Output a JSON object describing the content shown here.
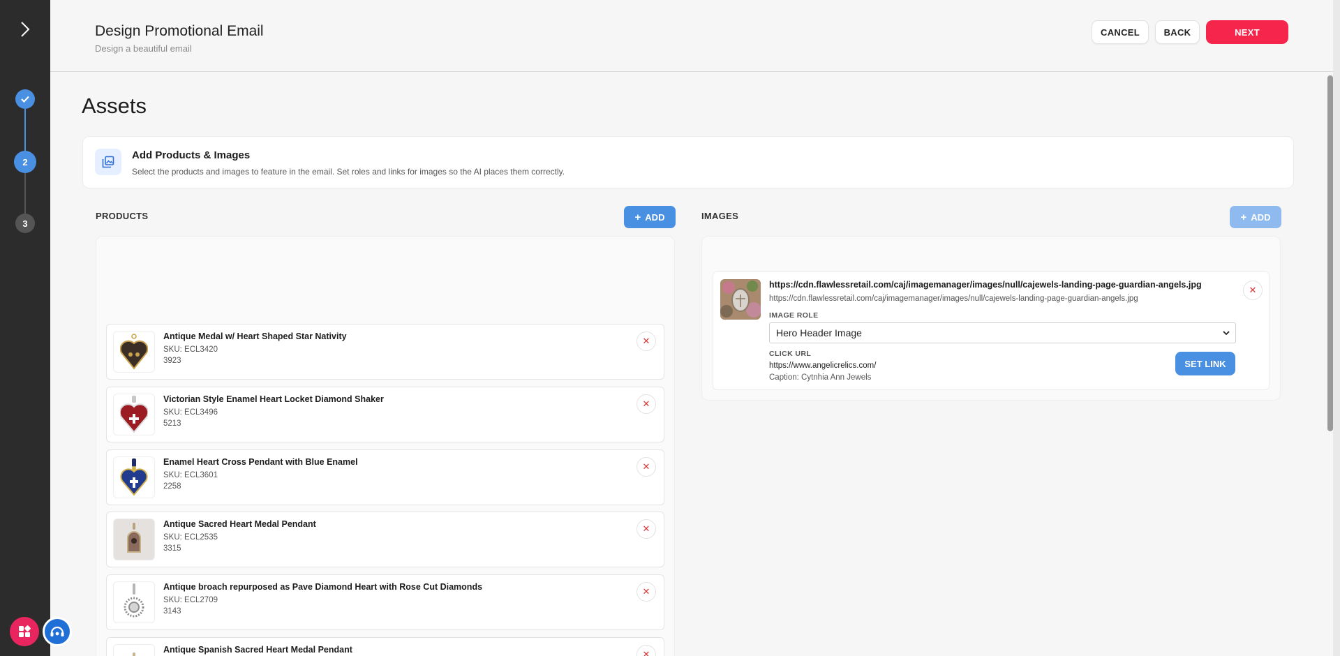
{
  "header": {
    "title": "Design Promotional Email",
    "subtitle": "Design a beautiful email",
    "cancel_label": "CANCEL",
    "back_label": "BACK",
    "next_label": "NEXT"
  },
  "steps": [
    {
      "label": "",
      "state": "done",
      "icon": "check-icon"
    },
    {
      "label": "2",
      "state": "active"
    },
    {
      "label": "3",
      "state": "todo"
    }
  ],
  "page": {
    "title": "Assets",
    "info_title": "Add Products & Images",
    "info_desc": "Select the products and images to feature in the email. Set roles and links for images so the AI places them correctly."
  },
  "products": {
    "label": "PRODUCTS",
    "add_label": "ADD",
    "items": [
      {
        "name": "Antique Medal w/ Heart Shaped Star Nativity",
        "sku": "SKU: ECL3420",
        "qty": "3923",
        "thumb": "medal"
      },
      {
        "name": "Victorian Style Enamel Heart Locket Diamond Shaker",
        "sku": "SKU: ECL3496",
        "qty": "5213",
        "thumb": "red-heart"
      },
      {
        "name": "Enamel Heart Cross Pendant with Blue Enamel",
        "sku": "SKU: ECL3601",
        "qty": "2258",
        "thumb": "blue-heart"
      },
      {
        "name": "Antique Sacred Heart Medal Pendant",
        "sku": "SKU: ECL2535",
        "qty": "3315",
        "thumb": "sacred-medal"
      },
      {
        "name": "Antique broach repurposed as Pave Diamond Heart with Rose Cut Diamonds",
        "sku": "SKU: ECL2709",
        "qty": "3143",
        "thumb": "broach"
      },
      {
        "name": "Antique Spanish Sacred Heart Medal Pendant",
        "sku": "",
        "qty": "",
        "thumb": "spanish-medal"
      }
    ]
  },
  "images": {
    "label": "IMAGES",
    "add_label": "ADD",
    "items": [
      {
        "url_bold": "https://cdn.flawlessretail.com/caj/imagemanager/images/null/cajewels-landing-page-guardian-angels.jpg",
        "url": "https://cdn.flawlessretail.com/caj/imagemanager/images/null/cajewels-landing-page-guardian-angels.jpg",
        "role_label": "IMAGE ROLE",
        "role_value": "Hero Header Image",
        "click_label": "CLICK URL",
        "click_url": "https://www.angelicrelics.com/",
        "caption": "Caption: Cytnhia Ann Jewels",
        "set_link_label": "SET LINK"
      }
    ]
  },
  "colors": {
    "accent": "#4a90e2",
    "danger": "#f5254b",
    "rail": "#2c2c2c"
  }
}
